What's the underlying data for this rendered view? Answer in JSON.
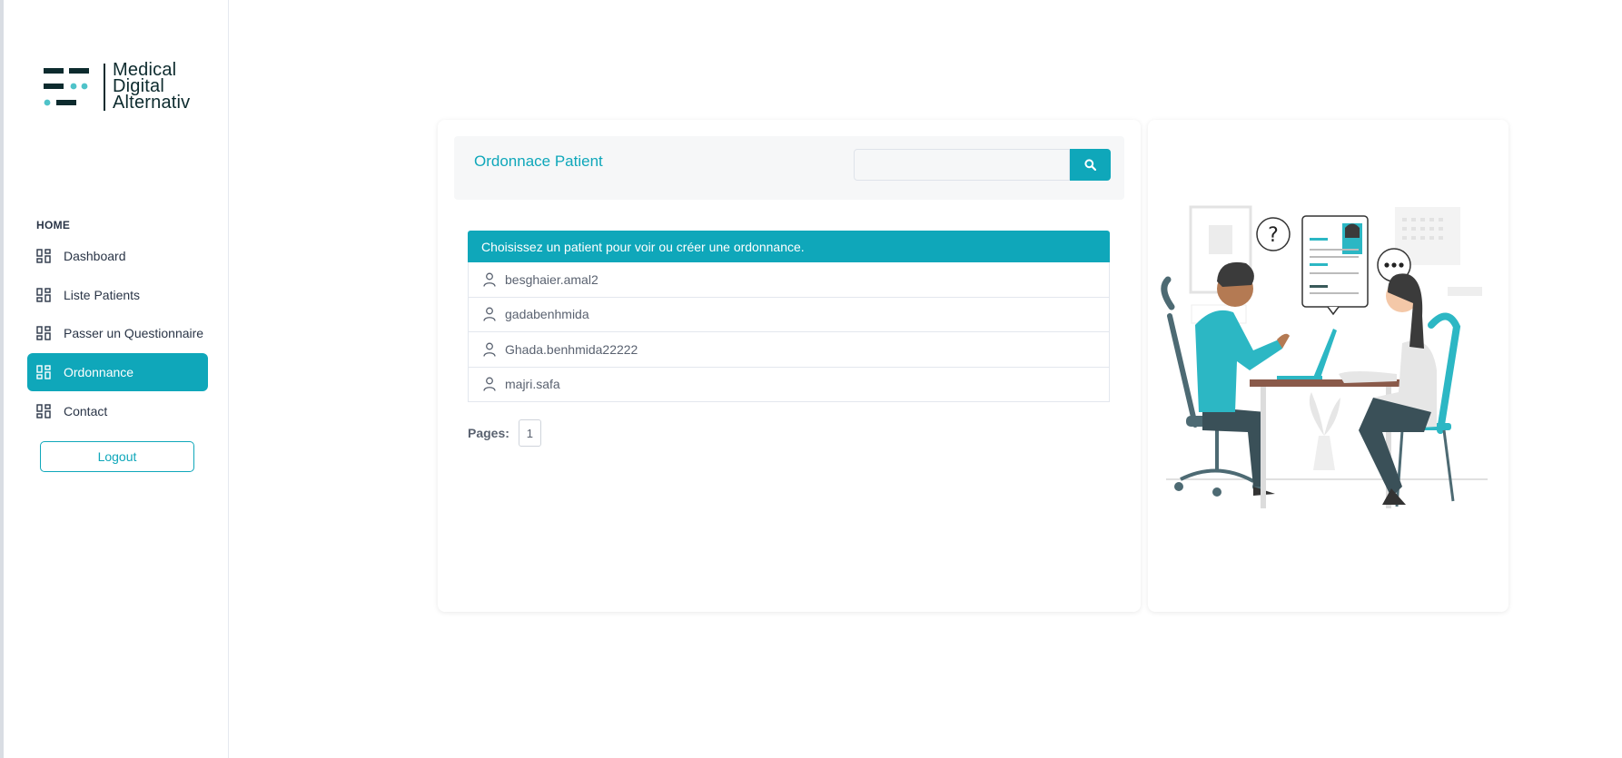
{
  "app": {
    "logo_lines": [
      "Medical",
      "Digital",
      "Alternativ"
    ],
    "accent_color": "#0fa7ba"
  },
  "sidebar": {
    "section_caption": "HOME",
    "items": [
      {
        "label": "Dashboard",
        "icon": "dashboard-icon",
        "active": false
      },
      {
        "label": "Liste Patients",
        "icon": "dashboard-icon",
        "active": false
      },
      {
        "label": "Passer un Questionnaire",
        "icon": "dashboard-icon",
        "active": false
      },
      {
        "label": "Ordonnance",
        "icon": "dashboard-icon",
        "active": true
      },
      {
        "label": "Contact",
        "icon": "dashboard-icon",
        "active": false
      }
    ],
    "logout_label": "Logout"
  },
  "main": {
    "title": "Ordonnace Patient",
    "search": {
      "value": "",
      "placeholder": "",
      "button_icon": "search-icon"
    },
    "list_header": "Choisissez un patient pour voir ou créer une ordonnance.",
    "patients": [
      "besghaier.amal2",
      "gadabenhmida",
      "Ghada.benhmida22222",
      "majri.safa"
    ],
    "pager_label": "Pages:",
    "pages": [
      "1"
    ]
  },
  "illustration": {
    "icon": "doctor-consultation-illustration"
  }
}
